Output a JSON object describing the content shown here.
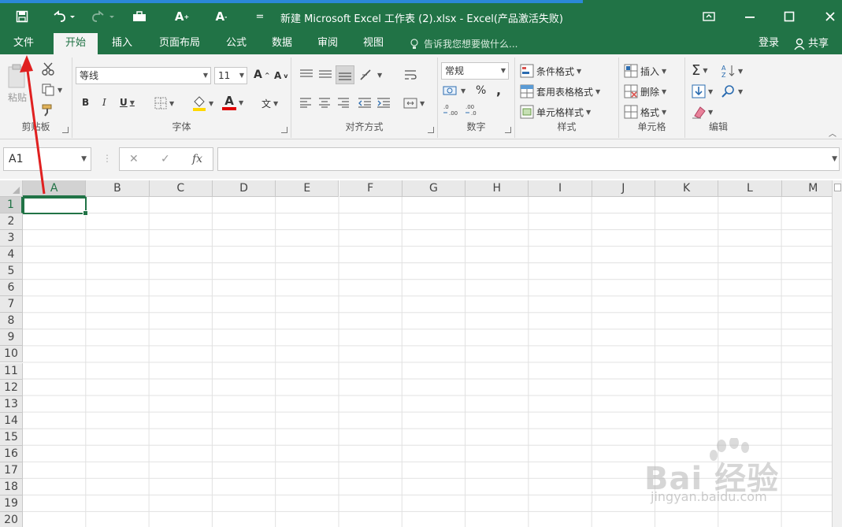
{
  "window": {
    "title": "新建 Microsoft Excel 工作表 (2).xlsx - Excel(产品激活失败)",
    "qa_customize": "="
  },
  "tabs": [
    {
      "label": "文件"
    },
    {
      "label": "开始"
    },
    {
      "label": "插入"
    },
    {
      "label": "页面布局"
    },
    {
      "label": "公式"
    },
    {
      "label": "数据"
    },
    {
      "label": "审阅"
    },
    {
      "label": "视图"
    }
  ],
  "tellme": {
    "placeholder": "告诉我您想要做什么..."
  },
  "account": {
    "login": "登录",
    "share": "共享"
  },
  "ribbon": {
    "clipboard": {
      "label": "剪贴板",
      "paste": "粘贴"
    },
    "font": {
      "label": "字体",
      "font_name": "等线",
      "font_size": "11",
      "increase": "A",
      "decrease": "A",
      "bold": "B",
      "italic": "I",
      "underline": "U",
      "font_color": "A",
      "phonetic": "文"
    },
    "alignment": {
      "label": "对齐方式"
    },
    "number": {
      "label": "数字",
      "format": "常规",
      "percent": "%",
      "comma": ","
    },
    "styles": {
      "label": "样式",
      "conditional": "条件格式",
      "table": "套用表格格式",
      "cell_styles": "单元格样式"
    },
    "cells": {
      "label": "单元格",
      "insert": "插入",
      "delete": "删除",
      "format": "格式"
    },
    "editing": {
      "label": "编辑"
    }
  },
  "formula_bar": {
    "name_box": "A1",
    "formula": ""
  },
  "grid": {
    "columns": [
      "A",
      "B",
      "C",
      "D",
      "E",
      "F",
      "G",
      "H",
      "I",
      "J",
      "K",
      "L",
      "M"
    ],
    "rows": [
      "1",
      "2",
      "3",
      "4",
      "5",
      "6",
      "7",
      "8",
      "9",
      "10",
      "11",
      "12",
      "13",
      "14",
      "15",
      "16",
      "17",
      "18",
      "19",
      "20"
    ],
    "active_cell": "A1"
  },
  "colors": {
    "accent": "#217346",
    "annotation": "#e02020"
  },
  "watermark": {
    "brand": "Bai 经验",
    "url": "jingyan.baidu.com"
  }
}
